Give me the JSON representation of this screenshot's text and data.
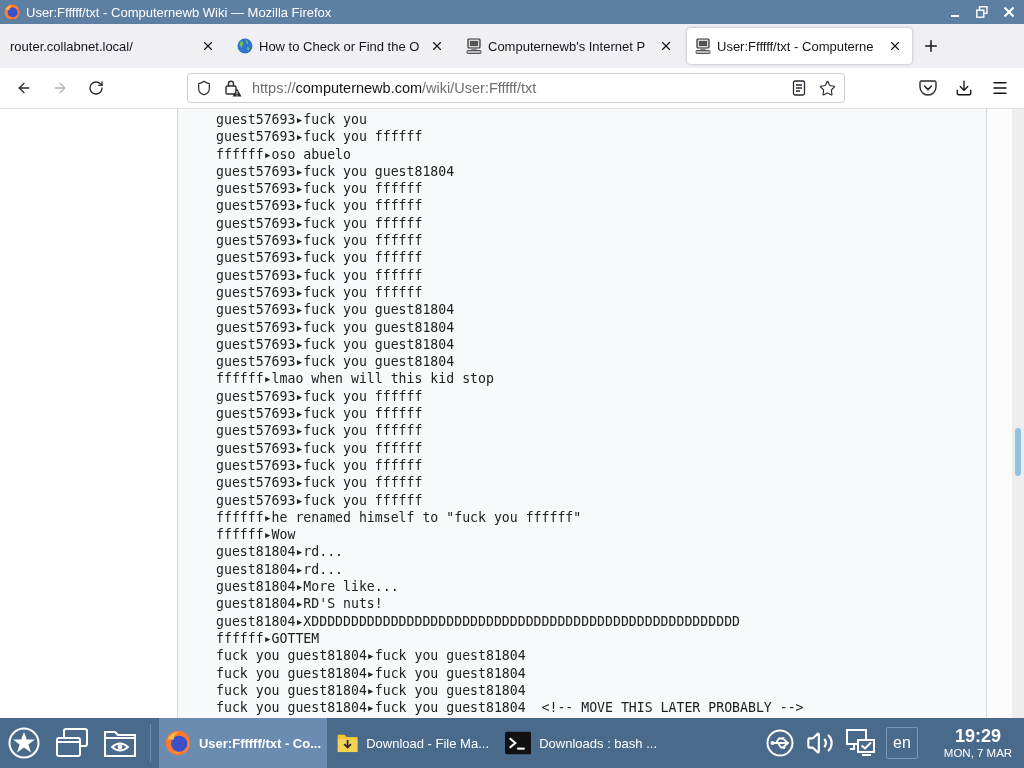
{
  "window": {
    "title": "User:Ffffff/txt - Computernewb Wiki — Mozilla Firefox"
  },
  "tabs": [
    {
      "label": "router.collabnet.local/",
      "kind": "blank",
      "selected": false
    },
    {
      "label": "How to Check or Find the O",
      "kind": "globe",
      "selected": false
    },
    {
      "label": "Computernewb's Internet P",
      "kind": "computer",
      "selected": false
    },
    {
      "label": "User:Ffffff/txt - Computerne",
      "kind": "computer",
      "selected": true
    }
  ],
  "toolbar": {
    "nav_buttons": [
      {
        "kind": "back",
        "disabled": false
      },
      {
        "kind": "forward",
        "disabled": true
      },
      {
        "kind": "reload",
        "disabled": false
      }
    ],
    "url": {
      "scheme": "https://",
      "host": "computernewb.com",
      "path": "/wiki/User:Ffffff/txt"
    }
  },
  "page": {
    "lines": [
      "guest57693▸fuck you",
      "guest57693▸fuck you ffffff",
      "ffffff▸oso abuelo",
      "guest57693▸fuck you guest81804",
      "guest57693▸fuck you ffffff",
      "guest57693▸fuck you ffffff",
      "guest57693▸fuck you ffffff",
      "guest57693▸fuck you ffffff",
      "guest57693▸fuck you ffffff",
      "guest57693▸fuck you ffffff",
      "guest57693▸fuck you ffffff",
      "guest57693▸fuck you guest81804",
      "guest57693▸fuck you guest81804",
      "guest57693▸fuck you guest81804",
      "guest57693▸fuck you guest81804",
      "ffffff▸lmao when will this kid stop",
      "guest57693▸fuck you ffffff",
      "guest57693▸fuck you ffffff",
      "guest57693▸fuck you ffffff",
      "guest57693▸fuck you ffffff",
      "guest57693▸fuck you ffffff",
      "guest57693▸fuck you ffffff",
      "guest57693▸fuck you ffffff",
      "ffffff▸he renamed himself to \"fuck you ffffff\"",
      "ffffff▸Wow",
      "guest81804▸rd...",
      "guest81804▸rd...",
      "guest81804▸More like...",
      "guest81804▸RD'S nuts!",
      "guest81804▸XDDDDDDDDDDDDDDDDDDDDDDDDDDDDDDDDDDDDDDDDDDDDDDDDDDDDDD",
      "ffffff▸GOTTEM",
      "fuck you guest81804▸fuck you guest81804",
      "fuck you guest81804▸fuck you guest81804",
      "fuck you guest81804▸fuck you guest81804",
      "fuck you guest81804▸fuck you guest81804  <!-- MOVE THIS LATER PROBABLY -->"
    ]
  },
  "taskbar": {
    "tasks": [
      {
        "label": "User:Ffffff/txt - Co...",
        "kind": "browser",
        "selected": true
      },
      {
        "label": "Download - File Ma...",
        "kind": "files",
        "selected": false
      },
      {
        "label": "Downloads : bash ...",
        "kind": "terminal",
        "selected": false
      }
    ],
    "language": "en",
    "clock": {
      "time": "19:29",
      "date": "MON, 7 MAR"
    }
  }
}
